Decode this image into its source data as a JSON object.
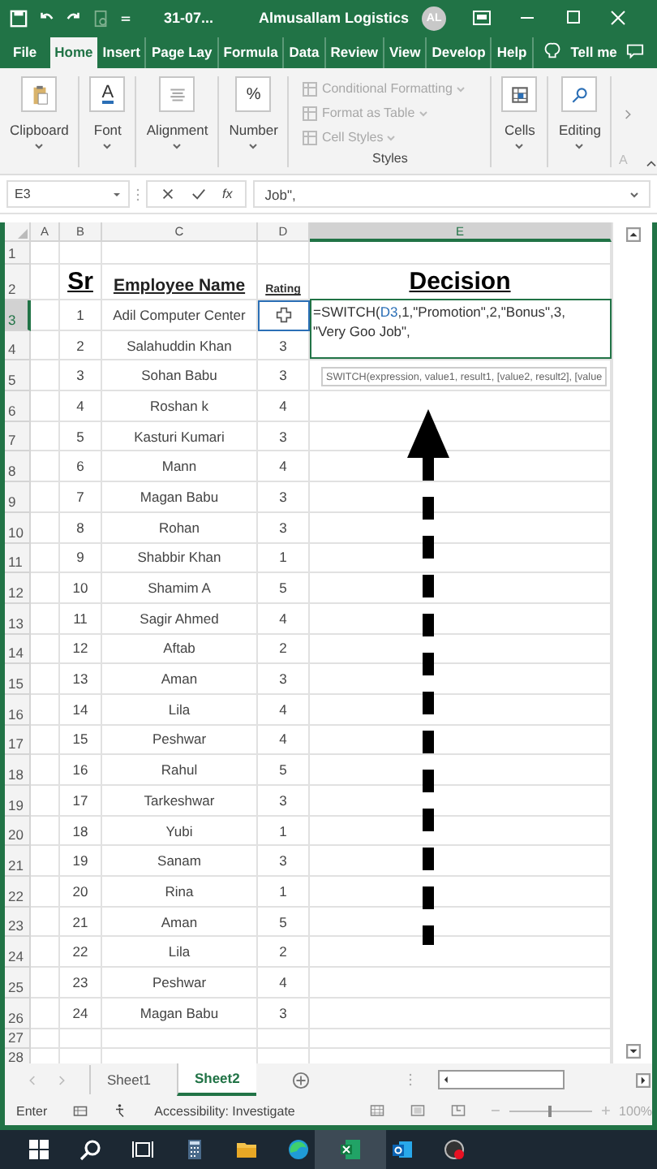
{
  "title_bar": {
    "file_name": "31-07...",
    "account": "Almusallam Logistics",
    "avatar": "AL"
  },
  "ribbon_tabs": [
    {
      "label": "File",
      "selected": false
    },
    {
      "label": "Home",
      "selected": true
    },
    {
      "label": "Insert",
      "selected": false
    },
    {
      "label": "Page Lay",
      "selected": false
    },
    {
      "label": "Formula",
      "selected": false
    },
    {
      "label": "Data",
      "selected": false
    },
    {
      "label": "Review",
      "selected": false
    },
    {
      "label": "View",
      "selected": false
    },
    {
      "label": "Develop",
      "selected": false
    },
    {
      "label": "Help",
      "selected": false
    }
  ],
  "tell_me": "Tell me",
  "ribbon_groups": [
    {
      "kind": "clipboard",
      "label": "Clipboard"
    },
    {
      "kind": "font",
      "label": "Font",
      "glyph": "A"
    },
    {
      "kind": "alignment",
      "label": "Alignment"
    },
    {
      "kind": "number",
      "label": "Number",
      "glyph": "%"
    },
    {
      "kind": "styles",
      "label": "Styles",
      "items": [
        {
          "label": "Conditional Formatting",
          "disabled": true
        },
        {
          "label": "Format as Table",
          "disabled": true
        },
        {
          "label": "Cell Styles",
          "disabled": true
        }
      ]
    },
    {
      "kind": "cells",
      "label": "Cells"
    },
    {
      "kind": "editing",
      "label": "Editing"
    },
    {
      "kind": "cut",
      "label": "A"
    }
  ],
  "formula_bar": {
    "name_box": "E3",
    "function_button": "fx",
    "content": "Job\","
  },
  "columns": [
    {
      "label": "A",
      "selected": false
    },
    {
      "label": "B",
      "selected": false
    },
    {
      "label": "C",
      "selected": false
    },
    {
      "label": "D",
      "selected": false
    },
    {
      "label": "E",
      "selected": true
    }
  ],
  "row_numbers": [
    {
      "label": "1",
      "selected": false
    },
    {
      "label": "2",
      "selected": false
    },
    {
      "label": "3",
      "selected": true
    },
    {
      "label": "4",
      "selected": false
    },
    {
      "label": "5",
      "selected": false
    },
    {
      "label": "6",
      "selected": false
    },
    {
      "label": "7",
      "selected": false
    },
    {
      "label": "8",
      "selected": false
    },
    {
      "label": "9",
      "selected": false
    },
    {
      "label": "10",
      "selected": false
    },
    {
      "label": "11",
      "selected": false
    },
    {
      "label": "12",
      "selected": false
    },
    {
      "label": "13",
      "selected": false
    },
    {
      "label": "14",
      "selected": false
    },
    {
      "label": "15",
      "selected": false
    },
    {
      "label": "16",
      "selected": false
    },
    {
      "label": "17",
      "selected": false
    },
    {
      "label": "18",
      "selected": false
    },
    {
      "label": "19",
      "selected": false
    },
    {
      "label": "20",
      "selected": false
    },
    {
      "label": "21",
      "selected": false
    },
    {
      "label": "22",
      "selected": false
    },
    {
      "label": "23",
      "selected": false
    },
    {
      "label": "24",
      "selected": false
    },
    {
      "label": "25",
      "selected": false
    },
    {
      "label": "26",
      "selected": false
    },
    {
      "label": "27",
      "selected": false
    },
    {
      "label": "28",
      "selected": false
    }
  ],
  "headers": {
    "sr": "Sr",
    "name": "Employee Name",
    "rating": "Rating",
    "decision": "Decision"
  },
  "rows": [
    {
      "sr": "1",
      "name": "Adil Computer Center",
      "rating": ""
    },
    {
      "sr": "2",
      "name": "Salahuddin Khan",
      "rating": "3"
    },
    {
      "sr": "3",
      "name": "Sohan Babu",
      "rating": "3"
    },
    {
      "sr": "4",
      "name": "Roshan k",
      "rating": "4"
    },
    {
      "sr": "5",
      "name": "Kasturi Kumari",
      "rating": "3"
    },
    {
      "sr": "6",
      "name": "Mann",
      "rating": "4"
    },
    {
      "sr": "7",
      "name": "Magan Babu",
      "rating": "3"
    },
    {
      "sr": "8",
      "name": "Rohan",
      "rating": "3"
    },
    {
      "sr": "9",
      "name": "Shabbir Khan",
      "rating": "1"
    },
    {
      "sr": "10",
      "name": "Shamim A",
      "rating": "5"
    },
    {
      "sr": "11",
      "name": "Sagir Ahmed",
      "rating": "4"
    },
    {
      "sr": "12",
      "name": "Aftab",
      "rating": "2"
    },
    {
      "sr": "13",
      "name": "Aman",
      "rating": "3"
    },
    {
      "sr": "14",
      "name": "Lila",
      "rating": "4"
    },
    {
      "sr": "15",
      "name": "Peshwar",
      "rating": "4"
    },
    {
      "sr": "16",
      "name": "Rahul",
      "rating": "5"
    },
    {
      "sr": "17",
      "name": "Tarkeshwar",
      "rating": "3"
    },
    {
      "sr": "18",
      "name": "Yubi",
      "rating": "1"
    },
    {
      "sr": "19",
      "name": "Sanam",
      "rating": "3"
    },
    {
      "sr": "20",
      "name": "Rina",
      "rating": "1"
    },
    {
      "sr": "21",
      "name": "Aman",
      "rating": "5"
    },
    {
      "sr": "22",
      "name": "Lila",
      "rating": "2"
    },
    {
      "sr": "23",
      "name": "Peshwar",
      "rating": "4"
    },
    {
      "sr": "24",
      "name": "Magan Babu",
      "rating": "3"
    }
  ],
  "editor": {
    "parts": [
      {
        "kind": "text",
        "text": "=SWITCH("
      },
      {
        "kind": "ref",
        "text": "D3"
      },
      {
        "kind": "text",
        "text": ",1,\"Promotion\",2,\"Bonus\",3,"
      }
    ],
    "second_line": "\"Very Goo Job\",",
    "tooltip": "SWITCH(expression, value1, result1, [value2, result2], [value"
  },
  "sheets": [
    {
      "label": "Sheet1",
      "selected": false
    },
    {
      "label": "Sheet2",
      "selected": true
    }
  ],
  "status_bar": {
    "mode": "Enter",
    "accessibility": "Accessibility: Investigate",
    "zoom": "100%",
    "zoom_slider": {
      "level": 0.5
    }
  }
}
